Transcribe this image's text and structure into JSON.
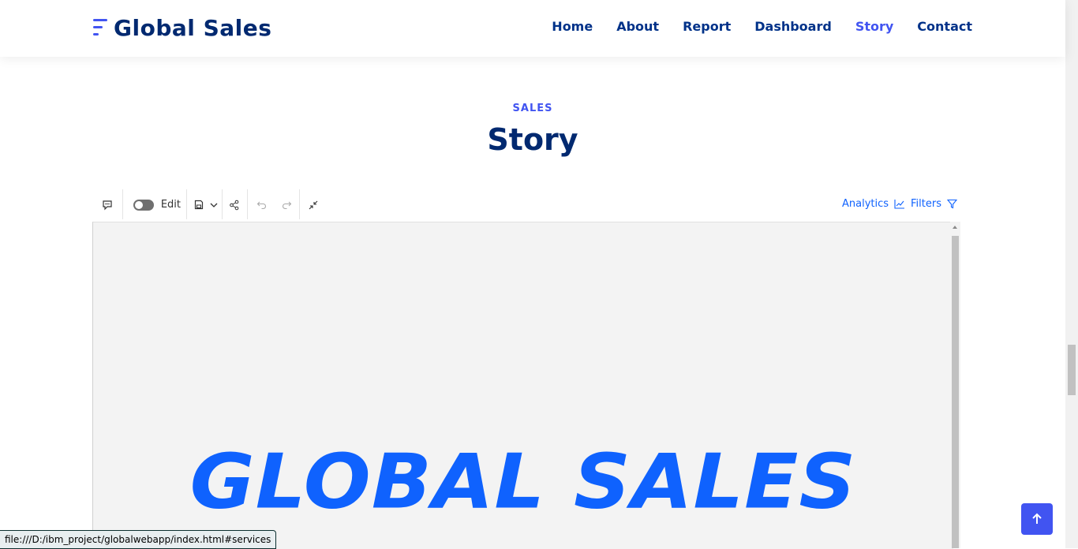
{
  "brand": {
    "name": "Global Sales"
  },
  "nav": {
    "items": [
      {
        "label": "Home"
      },
      {
        "label": "About"
      },
      {
        "label": "Report"
      },
      {
        "label": "Dashboard"
      },
      {
        "label": "Story",
        "active": true
      },
      {
        "label": "Contact"
      }
    ]
  },
  "section": {
    "subtitle": "SALES",
    "title": "Story"
  },
  "toolbar": {
    "edit_label": "Edit",
    "analytics_label": "Analytics",
    "filters_label": "Filters",
    "accent": "#0f62fe"
  },
  "story": {
    "banner_text": "GLOBAL SALES"
  },
  "statusbar": {
    "url": "file:///D:/ibm_project/globalwebapp/index.html#services"
  },
  "colors": {
    "brand_dark": "#012970",
    "accent": "#4154f1",
    "nav": "#013289"
  }
}
